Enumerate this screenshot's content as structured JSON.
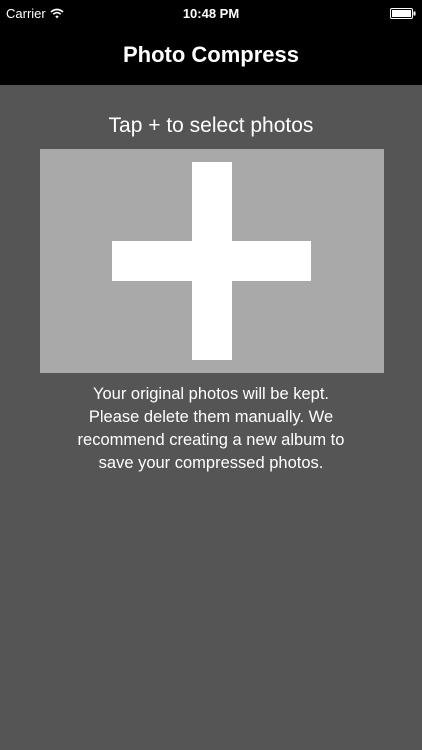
{
  "status_bar": {
    "carrier": "Carrier",
    "time": "10:48 PM",
    "wifi_icon": "wifi-icon",
    "battery_icon": "battery-icon"
  },
  "nav": {
    "title": "Photo Compress"
  },
  "main": {
    "instruction": "Tap + to select photos",
    "add_icon": "plus-icon",
    "note_lines": [
      "Your original photos will be kept.",
      "Please delete them manually. We",
      "recommend creating a new album to",
      "save your compressed photos."
    ]
  },
  "colors": {
    "background": "#555555",
    "nav_background": "#000000",
    "add_area": "#a9a9a9",
    "text": "#ffffff"
  }
}
